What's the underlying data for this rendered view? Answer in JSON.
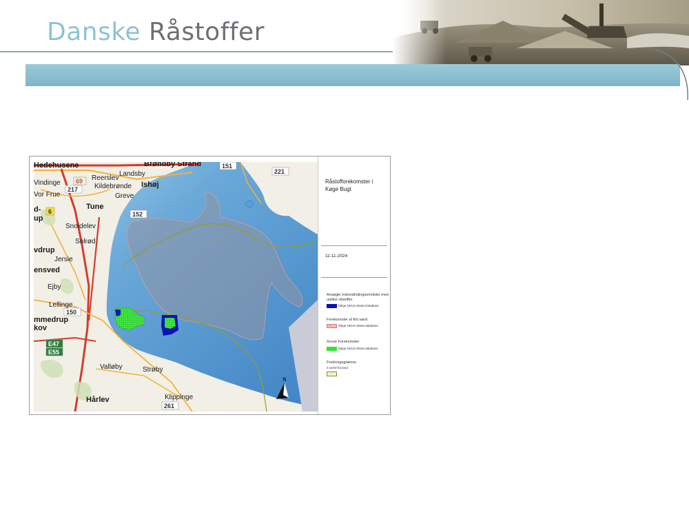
{
  "header": {
    "brand_part1": "Danske",
    "brand_part2": "Råstoffer"
  },
  "map": {
    "title": "Råstofforekomster i Køge Bugt",
    "date": "11-11-2024",
    "north_label": "N",
    "towns": [
      "Hedehusene",
      "Brøndby Strand",
      "Vindinge",
      "Landsby",
      "Reerslev",
      "Ishøj",
      "Kildebrønde",
      "Vor Frue",
      "Greve",
      "Tune",
      "Snoldelev",
      "Solrød",
      "vdrup",
      "Jersie",
      "ensved",
      "Ejby",
      "Lellinge",
      "mmedrup",
      "kov",
      "Valløby",
      "Strøby",
      "Hårlev",
      "Klippinge",
      "d-",
      "up"
    ],
    "road_numbers": [
      "217",
      "69",
      "6",
      "150",
      "151",
      "152",
      "221",
      "261",
      "E47",
      "E55"
    ],
    "legend": {
      "sections": [
        {
          "heading": "Ansøgte Indvindindingsområder med unikke råstoffer",
          "label": "Ifølge GEUS Marta Database",
          "swatch": "#0a14b4",
          "style": "fill"
        },
        {
          "heading": "Forekomster af fint sand",
          "label": "Ifølge GEUS Marta database",
          "swatch": "#e7a0a0",
          "style": "hatch"
        },
        {
          "heading": "Grove Forekomster",
          "label": "Ifølge GEUS Marta database",
          "swatch": "#32e632",
          "style": "fill"
        },
        {
          "heading": "Fredningsgrænse",
          "label": "3 sømil fra land",
          "swatch": "#8a8a2a",
          "style": "outline"
        }
      ]
    }
  },
  "colors": {
    "accent_bar": "#8cbfd0",
    "brand_light": "#8cc3d3",
    "brand_dark": "#6c7074",
    "sea": "#6aa9d8",
    "land": "#f2efe6"
  }
}
